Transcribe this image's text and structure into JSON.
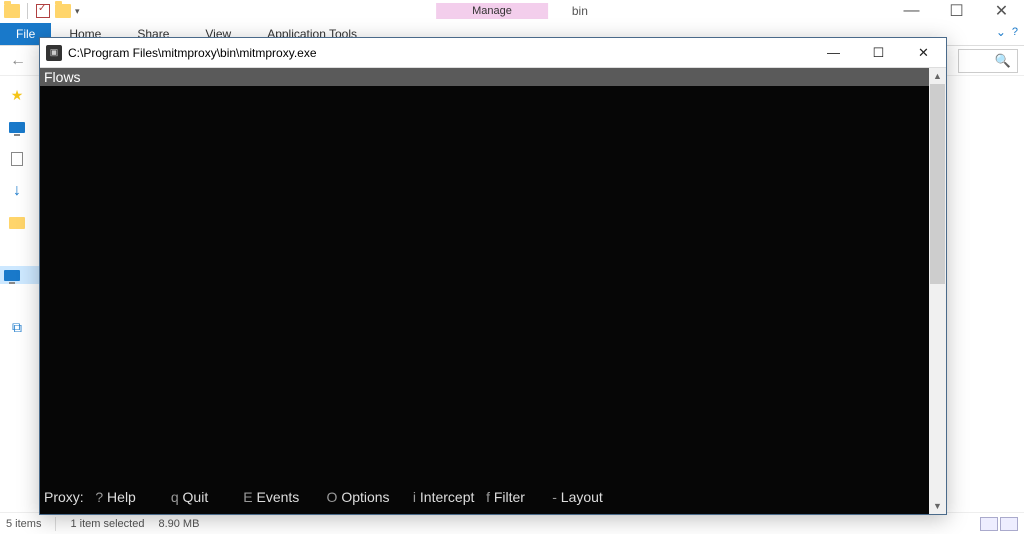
{
  "explorer": {
    "context_tab": "Manage",
    "location_name": "bin",
    "file_tab": "File",
    "tabs": [
      "Home",
      "Share",
      "View",
      "Application Tools"
    ],
    "nav_back": "←",
    "nav_fwd": "→",
    "status": {
      "items": "5 items",
      "selected": "1 item selected",
      "size": "8.90 MB"
    }
  },
  "console": {
    "title": "C:\\Program Files\\mitmproxy\\bin\\mitmproxy.exe",
    "header": "Flows",
    "footer": {
      "prefix": "Proxy:",
      "items": [
        {
          "key": "?",
          "label": "Help"
        },
        {
          "key": "q",
          "label": "Quit"
        },
        {
          "key": "E",
          "label": "Events"
        },
        {
          "key": "O",
          "label": "Options"
        },
        {
          "key": "i",
          "label": "Intercept"
        },
        {
          "key": "f",
          "label": "Filter"
        },
        {
          "key": "-",
          "label": "Layout"
        }
      ]
    }
  },
  "win_controls": {
    "min": "—",
    "max": "☐",
    "close": "✕"
  }
}
